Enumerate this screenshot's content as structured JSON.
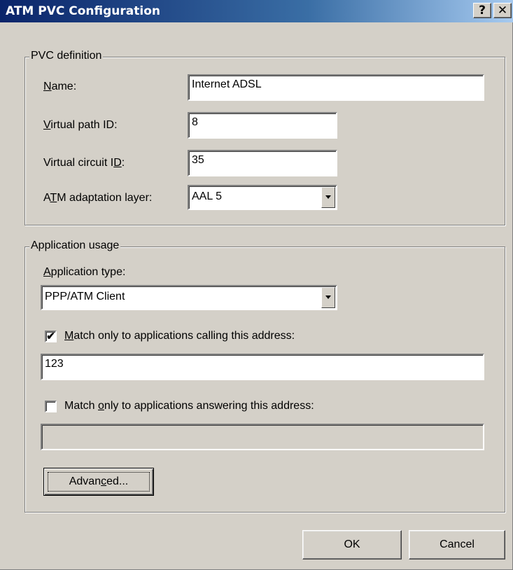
{
  "window": {
    "title": "ATM PVC Configuration",
    "help_glyph": "?",
    "close_glyph": "✕"
  },
  "pvc_definition": {
    "legend": "PVC definition",
    "name": {
      "pre": "",
      "accel": "N",
      "post": "ame:",
      "value": "Internet ADSL"
    },
    "vpi": {
      "pre": "",
      "accel": "V",
      "post": "irtual path ID:",
      "value": "8"
    },
    "vci": {
      "pre": "Virtual circuit I",
      "accel": "D",
      "post": ":",
      "value": "35"
    },
    "aal": {
      "pre": "A",
      "accel": "T",
      "post": "M adaptation layer:",
      "value": "AAL 5"
    }
  },
  "application_usage": {
    "legend": "Application usage",
    "type": {
      "pre": "",
      "accel": "A",
      "post": "pplication type:",
      "value": "PPP/ATM Client"
    },
    "match_calling": {
      "checked": true,
      "check_glyph": "✔",
      "pre": "",
      "accel": "M",
      "post": "atch only to applications calling this address:",
      "value": "123"
    },
    "match_answering": {
      "checked": false,
      "check_glyph": "",
      "pre": "Match ",
      "accel": "o",
      "post": "nly to applications answering this address:",
      "value": ""
    },
    "advanced": {
      "pre": "Advan",
      "accel": "c",
      "post": "ed..."
    }
  },
  "footer": {
    "ok_label": "OK",
    "cancel_label": "Cancel"
  }
}
